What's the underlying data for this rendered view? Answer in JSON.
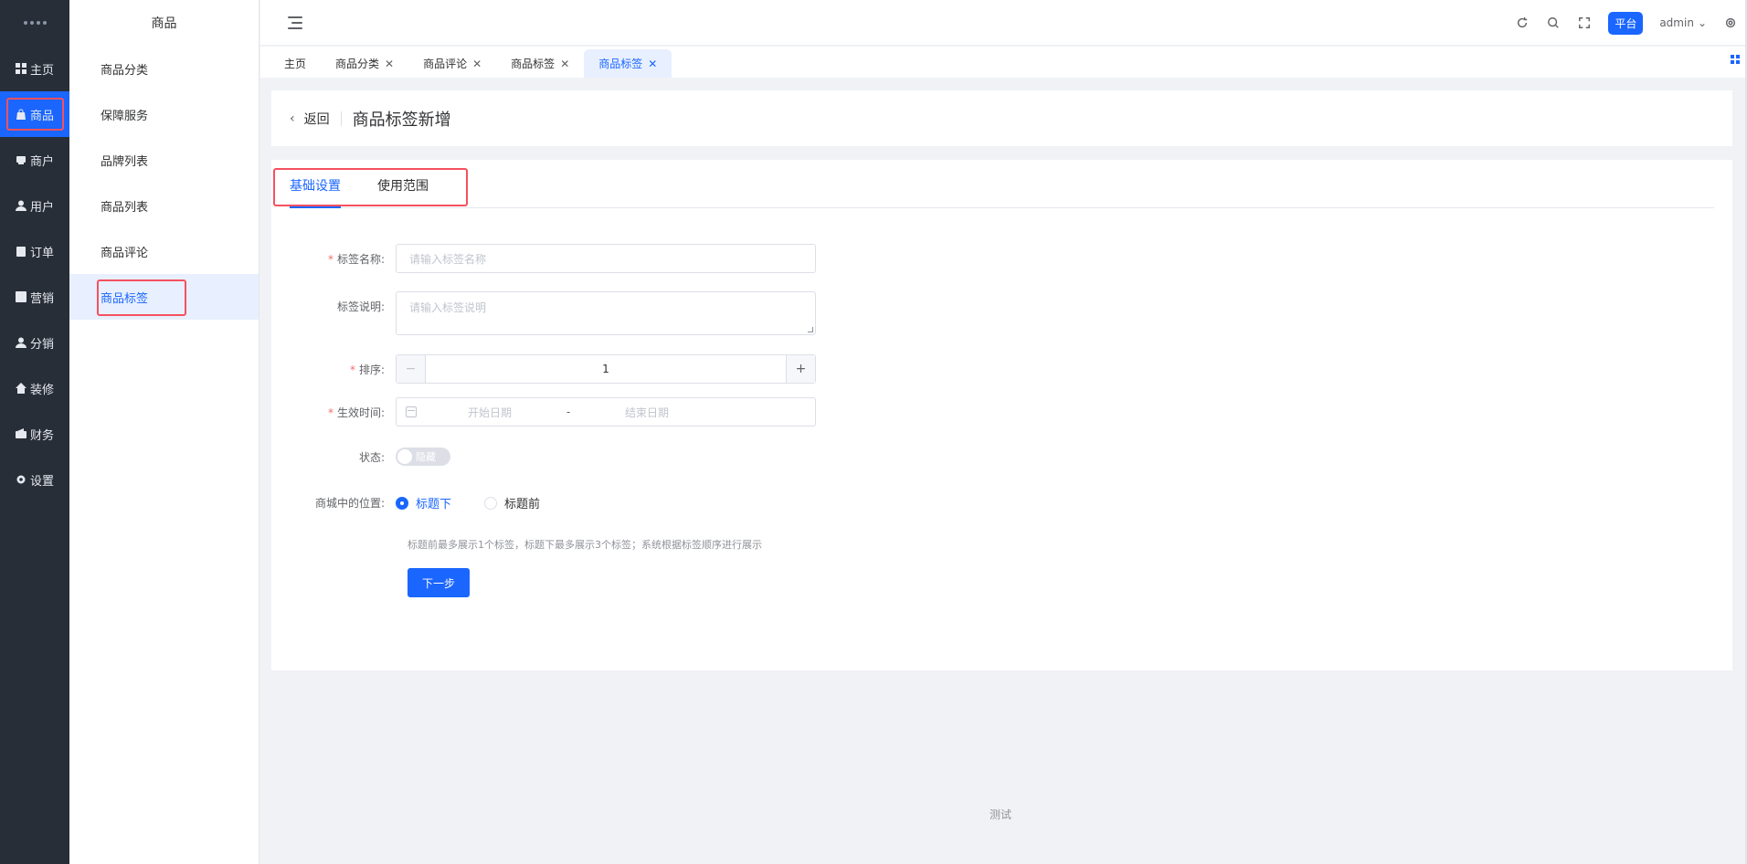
{
  "rail": {
    "items": [
      {
        "label": "主页",
        "icon": "grid-icon"
      },
      {
        "label": "商品",
        "icon": "bag-icon",
        "active": true
      },
      {
        "label": "商户",
        "icon": "store-icon"
      },
      {
        "label": "用户",
        "icon": "user-icon"
      },
      {
        "label": "订单",
        "icon": "clipboard-icon"
      },
      {
        "label": "营销",
        "icon": "chart-icon"
      },
      {
        "label": "分销",
        "icon": "user-icon"
      },
      {
        "label": "装修",
        "icon": "home-icon"
      },
      {
        "label": "财务",
        "icon": "wallet-icon"
      },
      {
        "label": "设置",
        "icon": "gear-icon"
      }
    ]
  },
  "sidebar": {
    "title": "商品",
    "items": [
      {
        "label": "商品分类"
      },
      {
        "label": "保障服务"
      },
      {
        "label": "品牌列表"
      },
      {
        "label": "商品列表"
      },
      {
        "label": "商品评论"
      },
      {
        "label": "商品标签",
        "active": true
      }
    ]
  },
  "header": {
    "platform": "平台",
    "user": "admin"
  },
  "tabs": [
    {
      "label": "主页",
      "closable": false
    },
    {
      "label": "商品分类",
      "closable": true
    },
    {
      "label": "商品评论",
      "closable": true
    },
    {
      "label": "商品标签",
      "closable": true
    },
    {
      "label": "商品标签",
      "closable": true,
      "active": true
    }
  ],
  "page": {
    "back": "返回",
    "title": "商品标签新增"
  },
  "form": {
    "tabs": [
      "基础设置",
      "使用范围"
    ],
    "name": {
      "label": "标签名称:",
      "placeholder": "请输入标签名称"
    },
    "desc": {
      "label": "标签说明:",
      "placeholder": "请输入标签说明"
    },
    "sort": {
      "label": "排序:",
      "value": "1",
      "minus": "−",
      "plus": "+"
    },
    "time": {
      "label": "生效时间:",
      "start": "开始日期",
      "sep": "-",
      "end": "结束日期"
    },
    "status": {
      "label": "状态:",
      "switch_text": "隐藏"
    },
    "position": {
      "label": "商城中的位置:",
      "options": [
        "标题下",
        "标题前"
      ]
    },
    "hint": "标题前最多展示1个标签，标题下最多展示3个标签；系统根据标签顺序进行展示",
    "next": "下一步"
  },
  "footer": "测试",
  "colors": {
    "accent": "#1a66ff",
    "rail": "#282e38",
    "highlight": "#f5515f"
  }
}
